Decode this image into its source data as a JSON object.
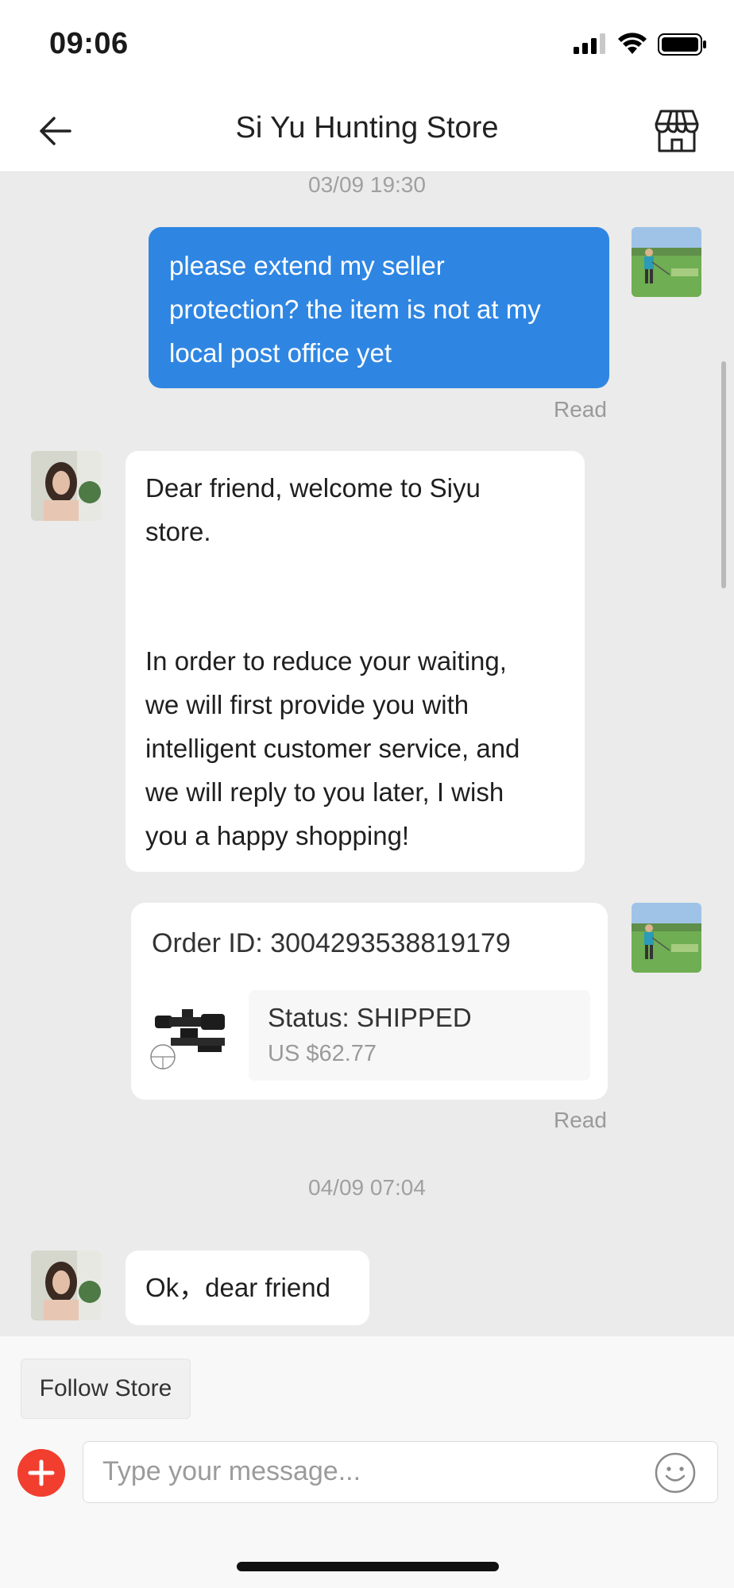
{
  "status_bar": {
    "time": "09:06"
  },
  "header": {
    "title": "Si Yu Hunting Store"
  },
  "chat": {
    "timestamp_1": "03/09 19:30",
    "msg_out_1": [
      "please extend my seller",
      "protection? the item is not at my",
      "local post office yet"
    ],
    "read_1": "Read",
    "msg_in_1": {
      "para1": [
        "Dear friend, welcome to Siyu",
        "store."
      ],
      "para2": [
        "In order to reduce your waiting,",
        "we will first provide you with",
        "intelligent customer service, and",
        "we will reply to you later, I wish",
        "you a happy shopping!"
      ]
    },
    "order_card": {
      "order_id": "Order ID: 3004293538819179",
      "status": "Status:  SHIPPED",
      "price": "US $62.77"
    },
    "read_2": "Read",
    "timestamp_2": "04/09 07:04",
    "msg_in_2": "Ok，dear friend"
  },
  "bottom": {
    "follow_label": "Follow Store",
    "input_placeholder": "Type your message..."
  },
  "colors": {
    "outgoing_bubble": "#2f86e2",
    "plus_button": "#f23e2f"
  }
}
